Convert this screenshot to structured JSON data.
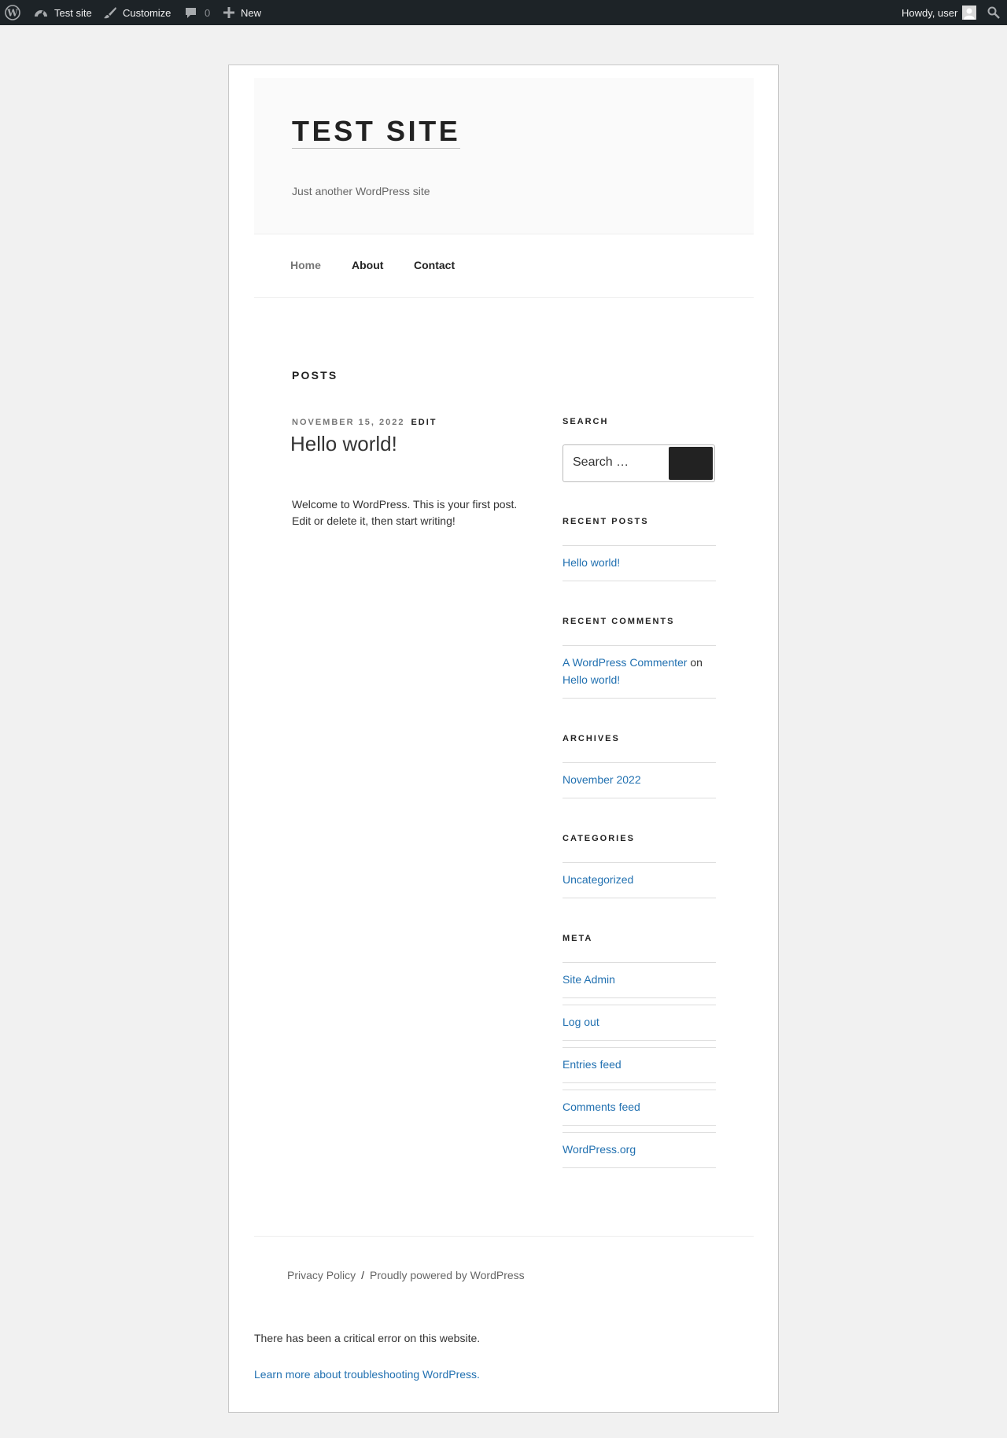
{
  "admin_bar": {
    "site_name": "Test site",
    "customize": "Customize",
    "comments_count": "0",
    "new": "New",
    "greeting": "Howdy, user"
  },
  "site": {
    "title": "TEST SITE",
    "tagline": "Just another WordPress site"
  },
  "nav": {
    "items": [
      {
        "label": "Home",
        "active": true
      },
      {
        "label": "About"
      },
      {
        "label": "Contact"
      }
    ]
  },
  "main": {
    "section_title": "POSTS",
    "post": {
      "date": "NOVEMBER 15, 2022",
      "edit": "EDIT",
      "title": "Hello world!",
      "excerpt": "Welcome to WordPress. This is your first post. Edit or delete it, then start writing!"
    }
  },
  "sidebar": {
    "search": {
      "title": "SEARCH",
      "placeholder": "Search …"
    },
    "recent_posts": {
      "title": "RECENT POSTS",
      "items": [
        "Hello world!"
      ]
    },
    "recent_comments": {
      "title": "RECENT COMMENTS",
      "author": "A WordPress Commenter",
      "on": "on",
      "post": "Hello world!"
    },
    "archives": {
      "title": "ARCHIVES",
      "items": [
        "November 2022"
      ]
    },
    "categories": {
      "title": "CATEGORIES",
      "items": [
        "Uncategorized"
      ]
    },
    "meta": {
      "title": "META",
      "items": [
        "Site Admin",
        "Log out",
        "Entries feed",
        "Comments feed",
        "WordPress.org"
      ]
    }
  },
  "footer": {
    "privacy": "Privacy Policy",
    "separator": "/",
    "powered": "Proudly powered by WordPress"
  },
  "error": {
    "message": "There has been a critical error on this website.",
    "link": "Learn more about troubleshooting WordPress."
  },
  "colors": {
    "admin_bar_bg": "#1d2327",
    "link": "#2271b1",
    "page_bg": "#f1f1f1"
  }
}
